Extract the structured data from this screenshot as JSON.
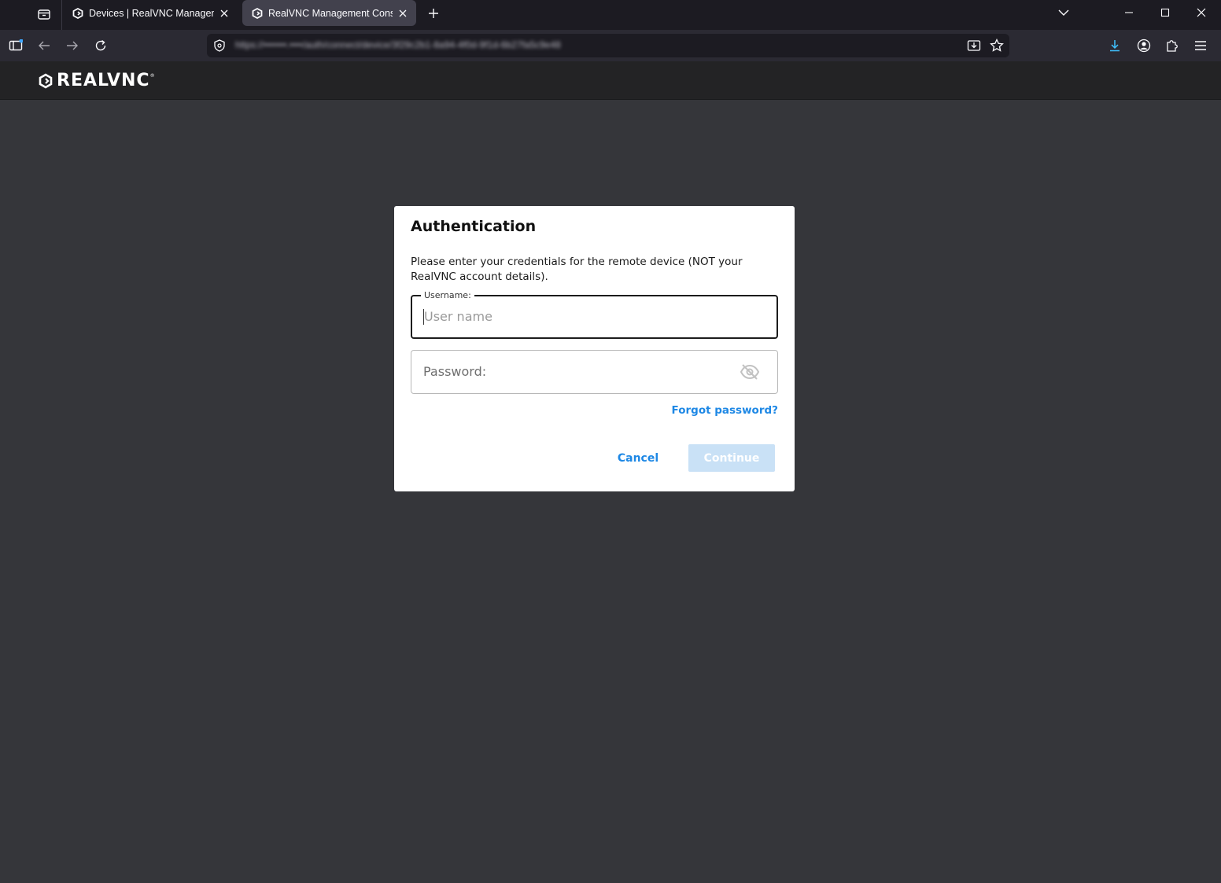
{
  "browser": {
    "tabs": [
      {
        "title": "Devices | RealVNC Management Console",
        "active": false
      },
      {
        "title": "RealVNC Management Console",
        "active": true
      }
    ],
    "url_text": "https://•••••••.••••/auth/connect/device/3f29c2b1-8a94-4f0d-9f1d-6b27fa5c9e48"
  },
  "app": {
    "logo_text": "REALVNC",
    "logo_mark": "®"
  },
  "dialog": {
    "title": "Authentication",
    "description": "Please enter your credentials for the remote device (NOT your RealVNC account details).",
    "username": {
      "label": "Username:",
      "placeholder": "User name",
      "value": ""
    },
    "password": {
      "placeholder": "Password:",
      "value": ""
    },
    "forgot_link": "Forgot password?",
    "cancel_label": "Cancel",
    "continue_label": "Continue"
  },
  "colors": {
    "accent": "#1e88e5",
    "continue_disabled_bg": "#c9e1f6",
    "page_bg": "#35363a",
    "header_bg": "#232325"
  },
  "icons": {
    "tab_list": "tab-list-icon",
    "favicon": "realvnc-favicon-icon",
    "close": "close-icon",
    "new_tab": "plus-icon",
    "sidebar": "sidebar-icon",
    "back": "arrow-left-icon",
    "forward": "arrow-right-icon",
    "reload": "reload-icon",
    "shield": "shield-icon",
    "save_page": "save-page-icon",
    "bookmark": "star-icon",
    "downloads": "download-icon",
    "account": "account-icon",
    "extensions": "puzzle-icon",
    "menu": "hamburger-icon",
    "password_visibility": "eye-off-icon"
  }
}
